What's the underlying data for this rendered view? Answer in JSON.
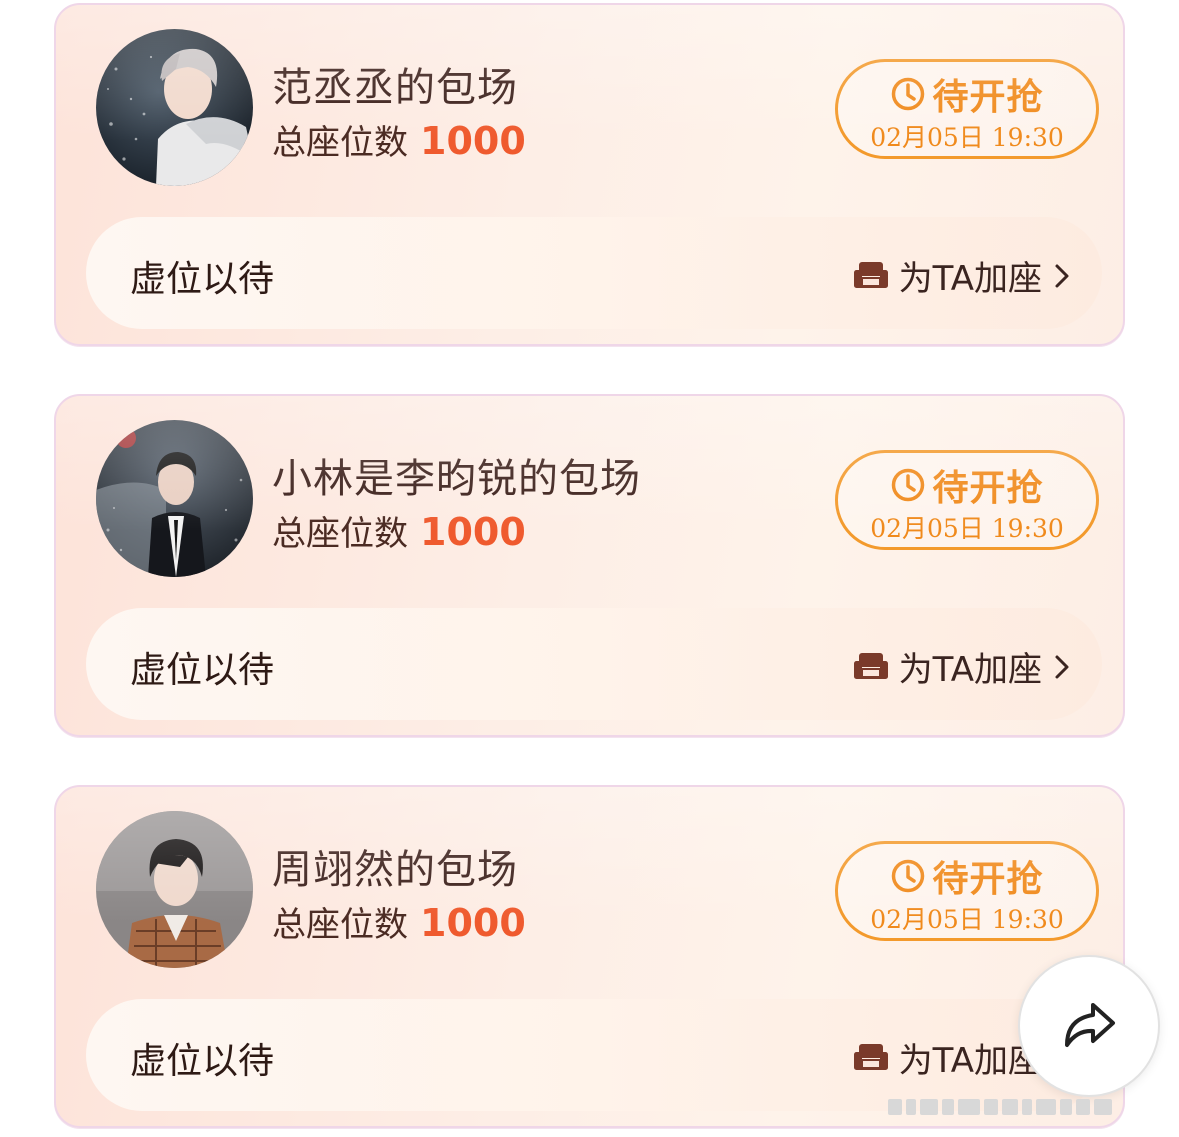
{
  "cards": [
    {
      "title": "范丞丞的包场",
      "seats_label": "总座位数",
      "seats_count": "1000",
      "status_label": "待开抢",
      "status_time": "02月05日 19:30",
      "bar_label": "虚位以待",
      "add_seat_label": "为TA加座"
    },
    {
      "title": "小林是李昀锐的包场",
      "seats_label": "总座位数",
      "seats_count": "1000",
      "status_label": "待开抢",
      "status_time": "02月05日 19:30",
      "bar_label": "虚位以待",
      "add_seat_label": "为TA加座"
    },
    {
      "title": "周翊然的包场",
      "seats_label": "总座位数",
      "seats_count": "1000",
      "status_label": "待开抢",
      "status_time": "02月05日 19:30",
      "bar_label": "虚位以待",
      "add_seat_label": "为TA加座"
    }
  ],
  "icons": {
    "status": "clock-icon",
    "add_seat": "sofa-icon",
    "chevron": "chevron-right-icon",
    "share": "share-arrow-icon"
  },
  "colors": {
    "accent_orange": "#f08a1c",
    "count_red": "#ef5a2e",
    "card_bg": "#fde9df",
    "icon_brown": "#7a3a2a"
  }
}
